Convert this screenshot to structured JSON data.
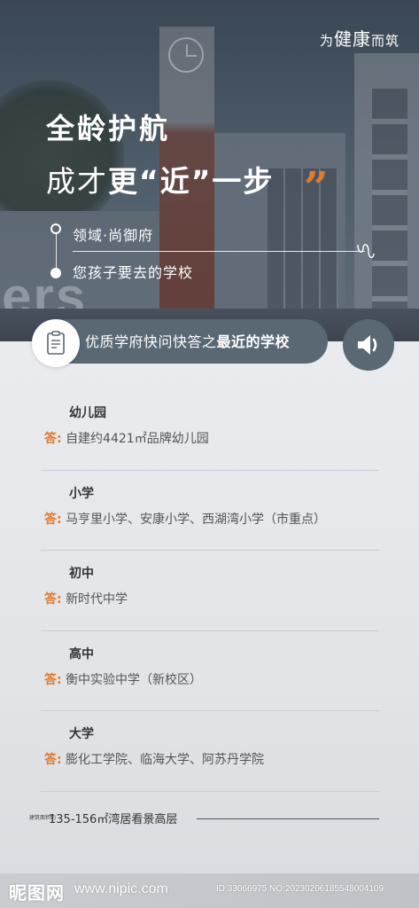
{
  "brand": {
    "prefix": "为",
    "main": "健康",
    "suffix": "而筑"
  },
  "hero": {
    "headline1": "全龄护航",
    "headline2_light": "成才",
    "headline2_bold": "更“近”一步",
    "quote_mark": "”",
    "tagline1": "领域·尚御府",
    "tagline2": "您孩子要去的学校",
    "sign_text": "ers"
  },
  "qa_banner": {
    "title_normal": "优质学府快问快答之",
    "title_bold": "最近的学校",
    "icon": "clipboard-icon",
    "sound_icon": "speaker-icon"
  },
  "answer_mark": "答:",
  "items": [
    {
      "question": "幼儿园",
      "answer": "自建约4421㎡品牌幼儿园"
    },
    {
      "question": "小学",
      "answer": "马亨里小学、安康小学、西湖湾小学（市重点）"
    },
    {
      "question": "初中",
      "answer": "新时代中学"
    },
    {
      "question": "高中",
      "answer": "衡中实验中学（新校区）"
    },
    {
      "question": "大学",
      "answer": "膨化工学院、临海大学、阿苏丹学院"
    }
  ],
  "footer": {
    "small": "建筑面积约",
    "text": "135-156㎡湾居看景高层"
  },
  "watermark": {
    "logo": "昵图网",
    "url": "www.nipic.com",
    "id": "ID:33066975 NO:20230206185548004109"
  },
  "colors": {
    "accent": "#e07b2e",
    "banner": "#5a6874",
    "divider": "#c6cfdc"
  }
}
